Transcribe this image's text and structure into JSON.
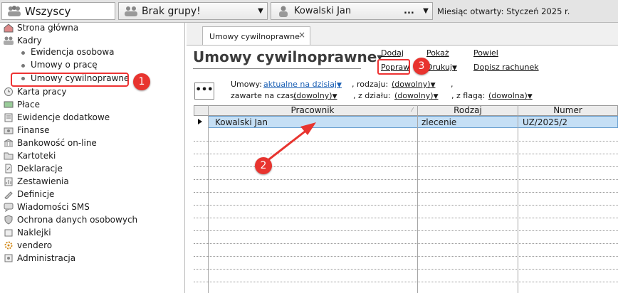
{
  "topbar": {
    "combo1": "Wszyscy",
    "combo2": "Brak grupy!",
    "combo3": "Kowalski Jan",
    "combo3_more": "...",
    "month_label": "Miesiąc otwarty:",
    "month_value": "Styczeń 2025 r."
  },
  "sidebar": {
    "items": [
      {
        "label": "Strona główna",
        "icon": "home-icon"
      },
      {
        "label": "Kadry",
        "icon": "people-icon"
      },
      {
        "label": "Karta pracy",
        "icon": "clock-icon"
      },
      {
        "label": "Płace",
        "icon": "money-icon"
      },
      {
        "label": "Ewidencje dodatkowe",
        "icon": "list-icon"
      },
      {
        "label": "Finanse",
        "icon": "finance-icon"
      },
      {
        "label": "Bankowość on-line",
        "icon": "bank-icon"
      },
      {
        "label": "Kartoteki",
        "icon": "folder-icon"
      },
      {
        "label": "Deklaracje",
        "icon": "document-icon"
      },
      {
        "label": "Zestawienia",
        "icon": "report-icon"
      },
      {
        "label": "Definicje",
        "icon": "definition-icon"
      },
      {
        "label": "Wiadomości SMS",
        "icon": "sms-icon"
      },
      {
        "label": "Ochrona danych osobowych",
        "icon": "shield-icon"
      },
      {
        "label": "Naklejki",
        "icon": "label-icon"
      },
      {
        "label": "vendero",
        "icon": "gear-icon"
      },
      {
        "label": "Administracja",
        "icon": "admin-icon"
      }
    ],
    "subitems": [
      "Ewidencja osobowa",
      "Umowy o pracę",
      "Umowy cywilnoprawne"
    ]
  },
  "tab": {
    "label": "Umowy cywilnoprawne",
    "close": "×"
  },
  "page": {
    "title": "Umowy cywilnoprawne",
    "actions": {
      "dodaj": "Dodaj",
      "popraw": "Popraw",
      "pokaz": "Pokaż",
      "drukuj": "Drukuj",
      "powiel": "Powiel",
      "dopisz": "Dopisz rachunek"
    }
  },
  "filters": {
    "more_button": "•••",
    "umowy_label": "Umowy:",
    "umowy_value": "aktualne na dzisiaj",
    "rodzaju_label": ", rodzaju:",
    "rodzaju_value": "(dowolny)",
    "comma": ",",
    "zawarte_label": "zawarte na czas:",
    "zawarte_value": "(dowolny)",
    "dzial_label": ", z działu:",
    "dzial_value": "(dowolny)",
    "flaga_label": ", z flagą:",
    "flaga_value": "(dowolna)"
  },
  "table": {
    "columns": [
      "Pracownik",
      "Rodzaj",
      "Numer"
    ],
    "rows": [
      {
        "pracownik": "Kowalski Jan",
        "rodzaj": "zlecenie",
        "numer": "UZ/2025/2"
      }
    ]
  },
  "annotations": {
    "badge1": "1",
    "badge2": "2",
    "badge3": "3"
  },
  "colors": {
    "annotation": "#e8342f",
    "selection": "#c5dff5",
    "link": "#1a5fb4"
  }
}
